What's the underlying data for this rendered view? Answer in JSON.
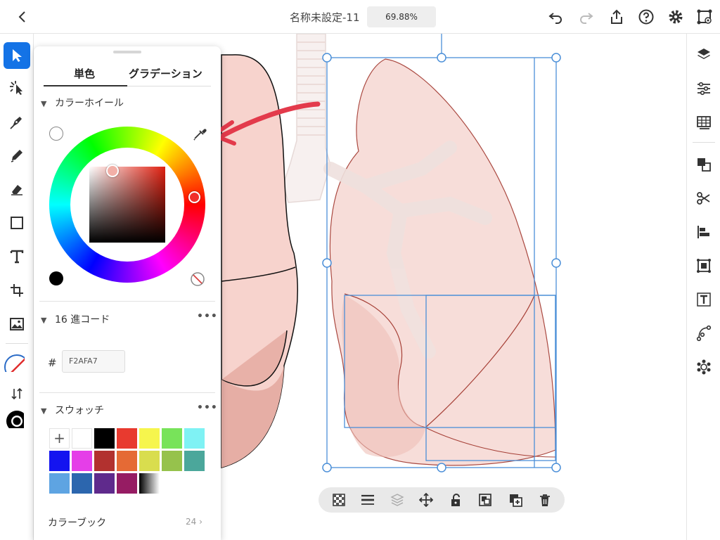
{
  "topbar": {
    "title": "名称未設定-11",
    "zoom": "69.88%"
  },
  "panel": {
    "tabs": [
      "単色",
      "グラデーション"
    ],
    "active_tab": "単色",
    "color_wheel_heading": "カラーホイール",
    "hex_heading": "16 進コード",
    "hex_hash": "#",
    "hex_value": "F2AFA7",
    "swatches_heading": "スウォッチ",
    "swatch_add": "+",
    "swatch_colors": [
      "#ffffff",
      "#000000",
      "#e83a2f",
      "#f6f54d",
      "#78e35a",
      "#7ff2f4",
      "#1414f0",
      "#e53ee8",
      "#b2312f",
      "#e56a35",
      "#d9dd4e",
      "#96c24c",
      "#4ba79b",
      "#5ea4e2",
      "#2c66ae",
      "#5f2a8c",
      "#961c63"
    ],
    "color_book_label": "カラーブック",
    "color_book_count": "24",
    "selected_color": "#F2AFA7"
  },
  "icons": {
    "top": [
      "back-chevron-icon",
      "undo-icon",
      "redo-icon",
      "share-icon",
      "help-icon",
      "settings-icon",
      "share-for-review-icon"
    ],
    "left": [
      "selection-tool-icon",
      "direct-selection-icon",
      "pen-tool-icon",
      "pencil-tool-icon",
      "eraser-tool-icon",
      "rectangle-tool-icon",
      "type-tool-icon",
      "transform-tool-icon",
      "place-image-icon",
      "fill-none-icon",
      "swap-fill-stroke-icon",
      "stroke-icon"
    ],
    "right": [
      "layers-icon",
      "properties-icon",
      "libraries-icon",
      "arrange-icon",
      "pathfinder-icon",
      "align-icon",
      "repeat-icon",
      "type-properties-icon",
      "path-icon",
      "effects-icon"
    ],
    "bottom": [
      "transparency-grid-icon",
      "stroke-weight-icon",
      "layer-order-icon",
      "move-icon",
      "unlock-icon",
      "group-icon",
      "duplicate-icon",
      "delete-icon"
    ]
  }
}
